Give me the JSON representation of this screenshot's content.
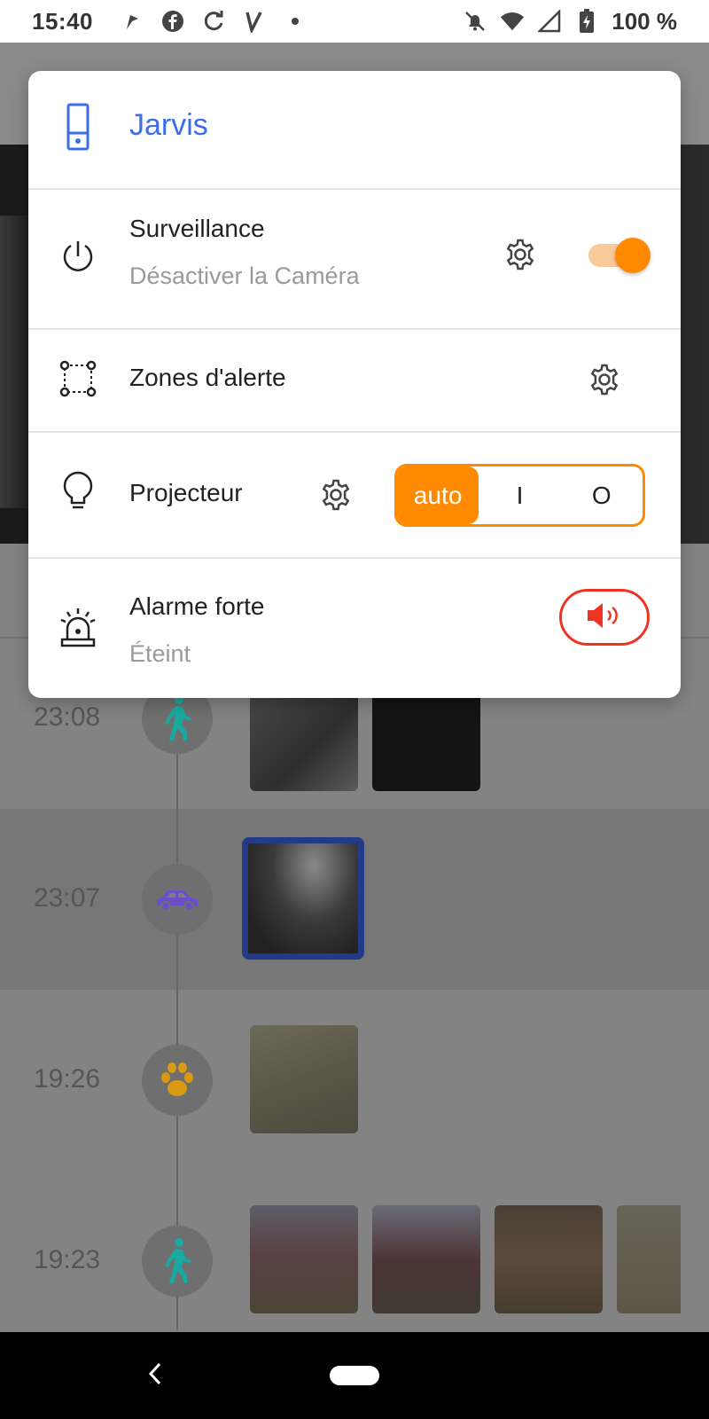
{
  "status_bar": {
    "time": "15:40",
    "battery": "100 %",
    "left_icons": [
      "flag-icon",
      "facebook-icon",
      "sync-icon",
      "v-app-icon",
      "dot-icon"
    ],
    "right_icons": [
      "bell-off-icon",
      "wifi-icon",
      "signal-icon",
      "battery-charging-icon"
    ]
  },
  "dialog": {
    "device": {
      "name": "Jarvis",
      "icon": "doorbell-camera-icon",
      "accent": "#3b6ee8"
    },
    "surveillance": {
      "title": "Surveillance",
      "subtitle": "Désactiver la Caméra",
      "enabled": true,
      "icon": "power-icon"
    },
    "alert_zones": {
      "title": "Zones d'alerte",
      "icon": "zone-select-icon"
    },
    "projector": {
      "title": "Projecteur",
      "icon": "lightbulb-icon",
      "options": [
        "auto",
        "I",
        "O"
      ],
      "selected": "auto"
    },
    "alarm": {
      "title": "Alarme forte",
      "subtitle": "Éteint",
      "icon": "siren-icon",
      "button_icon": "speaker-icon"
    }
  },
  "timeline": {
    "events": [
      {
        "time": "23:08",
        "type": "person"
      },
      {
        "time": "23:07",
        "type": "vehicle"
      },
      {
        "time": "19:26",
        "type": "animal"
      },
      {
        "time": "19:23",
        "type": "person"
      }
    ]
  },
  "colors": {
    "accent_orange": "#ff8a00",
    "alarm_red": "#ee3322",
    "person_teal": "#1aa9a0",
    "vehicle_purple": "#6b4fc8",
    "animal_gold": "#d99a12"
  }
}
